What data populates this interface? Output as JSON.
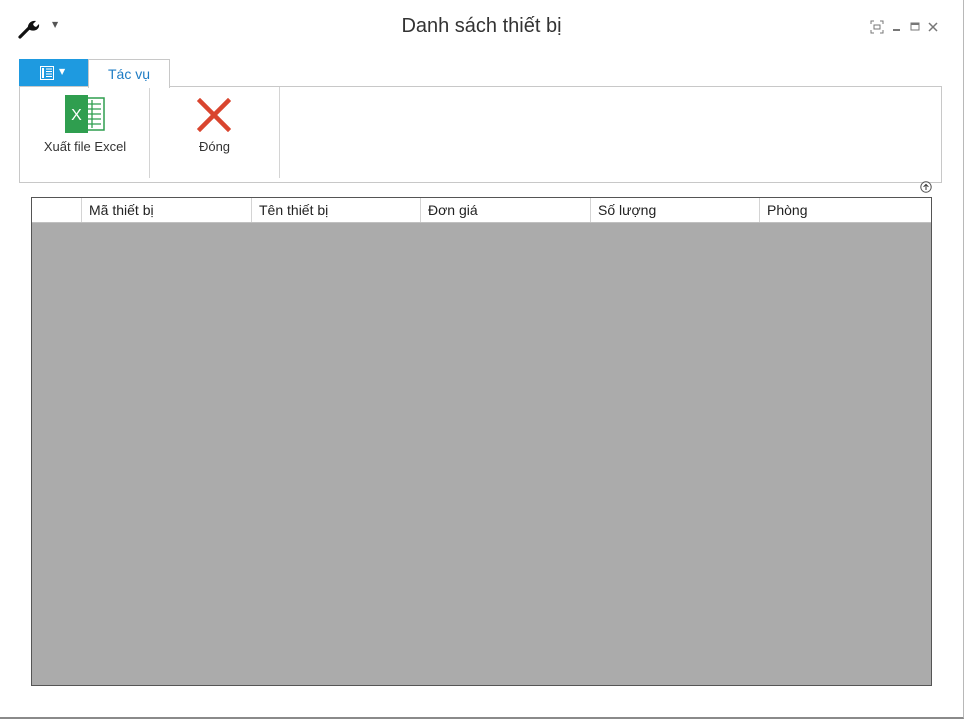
{
  "window": {
    "title": "Danh sách thiết bị"
  },
  "quick_access": {
    "app_icon": "wrench-icon",
    "dropdown_icon": "chevron-down-icon"
  },
  "window_controls": {
    "icons": [
      "fullscreen-icon",
      "minimize-icon",
      "maximize-icon",
      "close-icon"
    ]
  },
  "ribbon": {
    "file_tab_icon": "document-icon",
    "tabs": [
      {
        "label": "Tác vụ",
        "active": true
      }
    ],
    "buttons": [
      {
        "label": "Xuất file Excel",
        "icon": "excel-icon"
      },
      {
        "label": "Đóng",
        "icon": "close-red-icon"
      }
    ]
  },
  "grid": {
    "columns": [
      "Mã thiết bị",
      "Tên thiết bị",
      "Đơn giá",
      "Số lượng",
      "Phòng"
    ],
    "rows": []
  },
  "colors": {
    "accent": "#1e9ae0",
    "grid_background": "#ababab",
    "excel_green": "#2f9e4f",
    "close_red": "#d9452f"
  }
}
